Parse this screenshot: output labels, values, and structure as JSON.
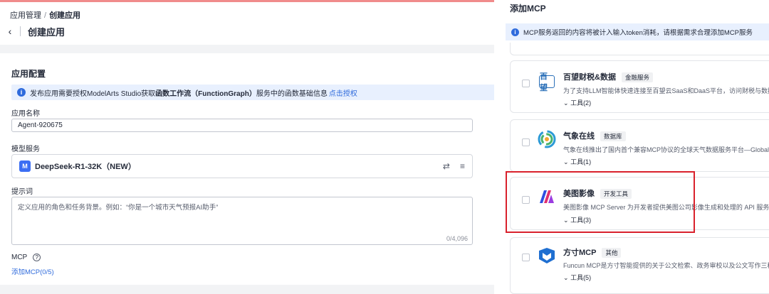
{
  "breadcrumb": {
    "parent": "应用管理",
    "separator": "/",
    "current": "创建应用"
  },
  "page_title": "创建应用",
  "section_title": "应用配置",
  "auth_notice": {
    "pre": "发布应用需要授权ModelArts Studio获取",
    "bold": "函数工作流（FunctionGraph）",
    "post": "服务中的函数基础信息",
    "link": "点击授权"
  },
  "app_name": {
    "label": "应用名称",
    "value": "Agent-920675"
  },
  "model": {
    "label": "模型服务",
    "name": "DeepSeek-R1-32K（NEW）"
  },
  "prompt": {
    "label": "提示词",
    "placeholder": "定义应用的角色和任务背景。例如：“你是一个城市天气预报AI助手”",
    "count": "0/4,096"
  },
  "mcp": {
    "label": "MCP",
    "add_link": "添加MCP(0/5)"
  },
  "drawer": {
    "title": "添加MCP",
    "notice": "MCP服务返回的内容将被计入输入token消耗，请根据需求合理添加MCP服务",
    "items": [
      {
        "name": "百望财税&数据",
        "tag": "金融服务",
        "desc": "为了支持LLM智能体快速连接至百望云SaaS和DaaS平台，访问财税与数据智能驱",
        "tools": "工具(2)",
        "logo": "百望"
      },
      {
        "name": "气象在线",
        "tag": "数据库",
        "desc": "气象在线推出了国内首个兼容MCP协议的全球天气数据服务平台—Global Weather",
        "tools": "工具(1)",
        "logo": ""
      },
      {
        "name": "美图影像",
        "tag": "开发工具",
        "desc": "美图影像 MCP Server 为开发者提供美图公司影像生成和处理的 API 服务。现包含",
        "tools": "工具(3)",
        "logo": ""
      },
      {
        "name": "方寸MCP",
        "tag": "其他",
        "desc": "Funcun MCP是方寸智能提供的关于公文检索、政务审校以及公文写作三种场景的M",
        "tools": "工具(5)",
        "logo": ""
      }
    ]
  },
  "colors": {
    "accent": "#2f6bdc",
    "highlight": "#d9212c"
  }
}
